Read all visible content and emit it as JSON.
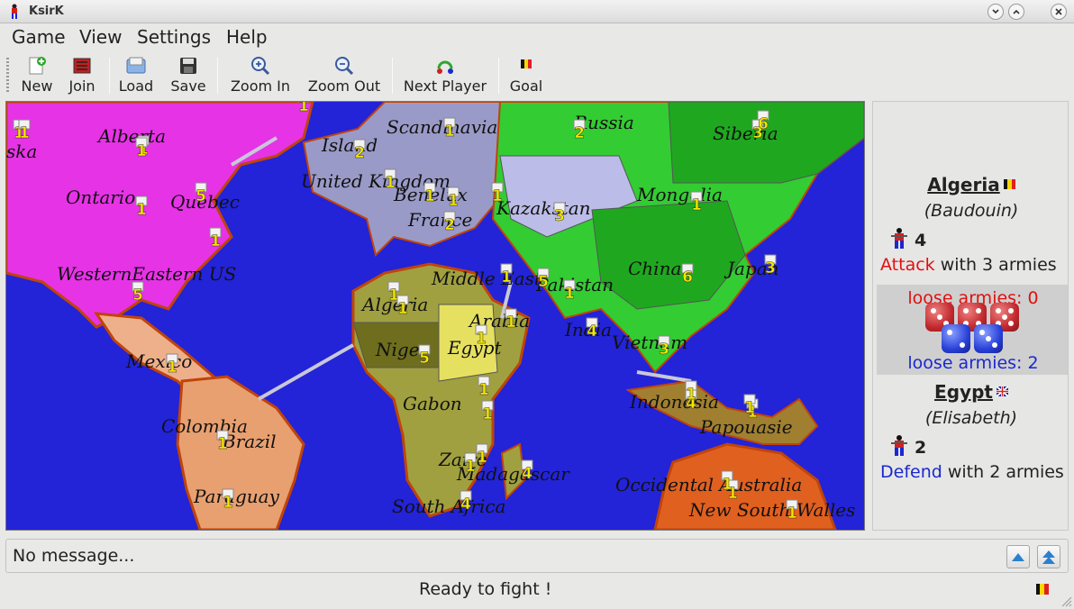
{
  "window": {
    "title": "KsirK"
  },
  "menu": [
    "Game",
    "View",
    "Settings",
    "Help"
  ],
  "toolbar": {
    "new": "New",
    "join": "Join",
    "load": "Load",
    "save": "Save",
    "zoom_in": "Zoom In",
    "zoom_out": "Zoom Out",
    "next_player": "Next Player",
    "goal": "Goal"
  },
  "map": {
    "labels": [
      "ska",
      "Alberta",
      "Ontario",
      "Quebec",
      "WesternEastern US",
      "Mexico",
      "Colombia",
      "Brazil",
      "Paraguay",
      "Island",
      "United Kingdom",
      "Benelux",
      "France",
      "Scandinavia",
      "Russia",
      "Siberia",
      "Mongolia",
      "Kazakstan",
      "China",
      "Japan",
      "Pakistan",
      "Middle East",
      "Arabia",
      "India",
      "Vietnam",
      "Algeria",
      "Niger",
      "Egypt",
      "Gabon",
      "Zaire",
      "Madagascar",
      "South Africa",
      "Indonesia",
      "Papouasie",
      "Occidental Australia",
      "New South Walles"
    ],
    "army_counts": [
      "1",
      "1",
      "1",
      "5",
      "1",
      "5",
      "1",
      "1",
      "1",
      "2",
      "1",
      "1",
      "2",
      "1",
      "2",
      "3",
      "1",
      "3",
      "6",
      "3",
      "1",
      "5",
      "1",
      "4",
      "3",
      "1",
      "5",
      "1",
      "1",
      "1",
      "4",
      "4",
      "4",
      "1",
      "1",
      "1",
      "1",
      "1",
      "1",
      "1",
      "1",
      "1",
      "1",
      "1",
      "1",
      "1",
      "1",
      "6",
      "1"
    ]
  },
  "attacker": {
    "country": "Algeria",
    "player": "(Baudouin)",
    "armies": "4",
    "action_word": "Attack",
    "action_rest": " with 3 armies",
    "flag": "belgium-flag-icon"
  },
  "dice": {
    "loose_red": "loose armies: 0",
    "loose_blue": "loose armies: 2",
    "red_color": "#c0282c",
    "blue_color": "#2840d8"
  },
  "defender": {
    "country": "Egypt",
    "player": "(Elisabeth)",
    "armies": "2",
    "action_word": "Defend",
    "action_rest": " with 2 armies",
    "flag": "uk-flag-icon"
  },
  "message": {
    "text": "No message..."
  },
  "status": {
    "text": "Ready to fight !"
  },
  "colors": {
    "ocean": "#2323d8",
    "north_america": "#e633e6",
    "south_america": "#e8a070",
    "europe": "#9a9ac8",
    "africa": "#a0a040",
    "asia": "#33cc33",
    "oceania": "#e06020",
    "attack": "#e01010",
    "defend": "#1a28d0"
  }
}
